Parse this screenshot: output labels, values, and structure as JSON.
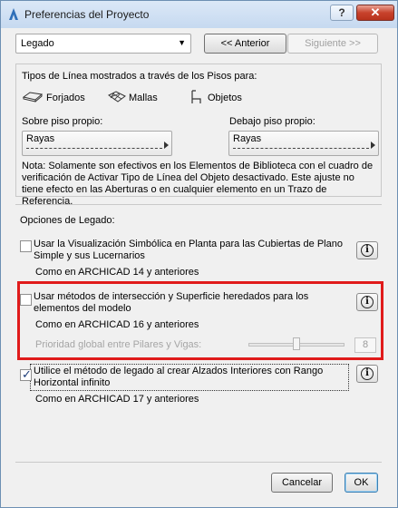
{
  "window": {
    "title": "Preferencias del Proyecto",
    "help_label": "?",
    "close_label": "✕"
  },
  "toolbar": {
    "preset_value": "Legado",
    "prev_label": "<< Anterior",
    "next_label": "Siguiente >>"
  },
  "linetypes": {
    "heading": "Tipos de Línea mostrados a través de los Pisos para:",
    "items": [
      {
        "label": "Forjados",
        "icon": "slab-icon"
      },
      {
        "label": "Mallas",
        "icon": "mesh-icon"
      },
      {
        "label": "Objetos",
        "icon": "chair-icon"
      }
    ],
    "own_floor_label": "Sobre piso propio:",
    "own_floor_value": "Rayas",
    "below_floor_label": "Debajo piso propio:",
    "below_floor_value": "Rayas",
    "note": "Nota: Solamente son efectivos en los Elementos de Biblioteca con el cuadro de verificación de Activar Tipo de Línea del Objeto desactivado. Este ajuste no tiene efecto en las Aberturas o en cualquier elemento en un Trazo de Referencia."
  },
  "legacy": {
    "heading": "Opciones de Legado:",
    "options": [
      {
        "label": "Usar la Visualización Simbólica en Planta para las Cubiertas de Plano Simple y sus Lucernarios",
        "sub": "Como en ARCHICAD 14 y anteriores",
        "checked": false
      },
      {
        "label": "Usar métodos de intersección y Superficie heredados para los elementos del modelo",
        "sub": "Como en ARCHICAD 16 y anteriores",
        "checked": false
      },
      {
        "label": "Utilice el método de legado al crear Alzados Interiores con Rango Horizontal infinito",
        "sub": "Como en ARCHICAD 17 y anteriores",
        "checked": true
      }
    ],
    "priority_label": "Prioridad global entre Pilares y Vigas:",
    "priority_value": "8",
    "priority_level_fraction": 0.5
  },
  "footer": {
    "cancel_label": "Cancelar",
    "ok_label": "OK"
  },
  "colors": {
    "highlight": "#e01b1b",
    "close_button": "#c8422c"
  }
}
